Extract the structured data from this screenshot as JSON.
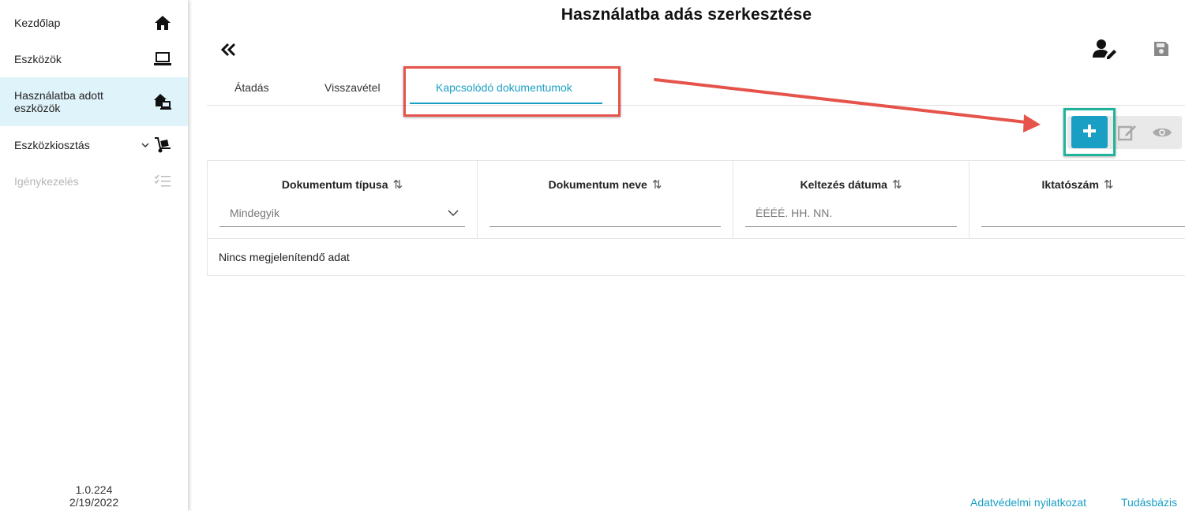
{
  "sidebar": {
    "items": [
      {
        "label": "Kezdőlap",
        "icon": "home-icon"
      },
      {
        "label": "Eszközök",
        "icon": "laptop-icon"
      },
      {
        "label": "Használatba adott eszközök",
        "icon": "house-laptop-icon"
      },
      {
        "label": "Eszközkiosztás",
        "icon": "dolly-icon"
      },
      {
        "label": "Igénykezelés",
        "icon": "checklist-icon"
      }
    ],
    "version": "1.0.224",
    "date": "2/19/2022"
  },
  "page": {
    "title": "Használatba adás szerkesztése"
  },
  "tabs": [
    {
      "label": "Átadás"
    },
    {
      "label": "Visszavétel"
    },
    {
      "label": "Kapcsolódó dokumentumok"
    }
  ],
  "table": {
    "columns": [
      {
        "header": "Dokumentum típusa",
        "filter_value": "Mindegyik"
      },
      {
        "header": "Dokumentum neve",
        "filter_value": ""
      },
      {
        "header": "Keltezés dátuma",
        "filter_placeholder": "ÉÉÉÉ. HH. NN."
      },
      {
        "header": "Iktatószám",
        "filter_value": ""
      }
    ],
    "sort_glyph": "⇅",
    "empty_text": "Nincs megjelenítendő adat"
  },
  "footer": {
    "privacy": "Adatvédelmi nyilatkozat",
    "knowledge": "Tudásbázis"
  },
  "colors": {
    "accent": "#1a9fc4",
    "active_nav_bg": "#dff3fa",
    "annotation_red": "#e5534b",
    "annotation_teal": "#20b59a"
  }
}
